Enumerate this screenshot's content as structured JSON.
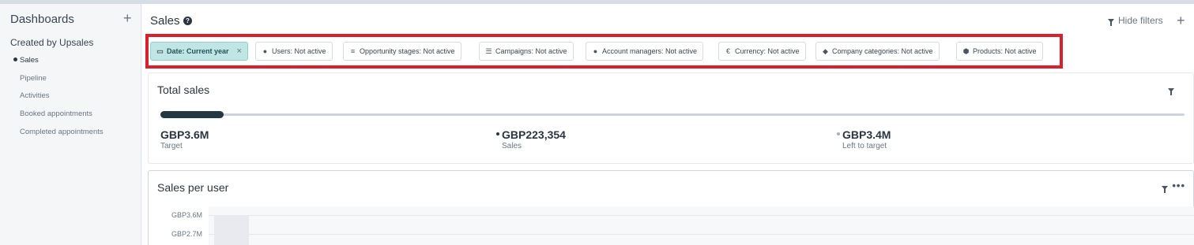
{
  "sidebar": {
    "title": "Dashboards",
    "add_label": "+",
    "section": "Created by Upsales",
    "items": [
      {
        "label": "Sales",
        "active": true
      },
      {
        "label": "Pipeline",
        "active": false
      },
      {
        "label": "Activities",
        "active": false
      },
      {
        "label": "Booked appointments",
        "active": false
      },
      {
        "label": "Completed appointments",
        "active": false
      }
    ]
  },
  "header": {
    "title": "Sales",
    "help_icon": "?",
    "hide_filters_label": "Hide filters",
    "add_label": "+"
  },
  "filters": [
    {
      "label": "Date: Current year",
      "icon": "calendar-icon",
      "active": true,
      "clear": "×"
    },
    {
      "label": "Users: Not active",
      "icon": "user-icon"
    },
    {
      "label": "Opportunity stages: Not active",
      "icon": "filter-icon"
    },
    {
      "label": "Campaigns: Not active",
      "icon": "list-icon"
    },
    {
      "label": "Account managers: Not active",
      "icon": "user-icon"
    },
    {
      "label": "Currency: Not active",
      "icon": "euro-icon",
      "symbol": "€"
    },
    {
      "label": "Company categories: Not active",
      "icon": "tags-icon"
    },
    {
      "label": "Products: Not active",
      "icon": "cube-icon"
    }
  ],
  "total_sales": {
    "title": "Total sales",
    "progress": 0.062,
    "target_value": "GBP3.6M",
    "target_label": "Target",
    "sales_value": "GBP223,354",
    "sales_label": "Sales",
    "left_value": "GBP3.4M",
    "left_label": "Left to target",
    "colors": {
      "sales": "#243844",
      "left": "#a7b0bc"
    }
  },
  "sales_per_user": {
    "title": "Sales per user",
    "more_label": "•••",
    "chart_data": {
      "type": "bar",
      "title": "Sales per user",
      "y_ticks": [
        "GBP3.6M",
        "GBP2.7M"
      ],
      "categories": [],
      "values": []
    }
  }
}
